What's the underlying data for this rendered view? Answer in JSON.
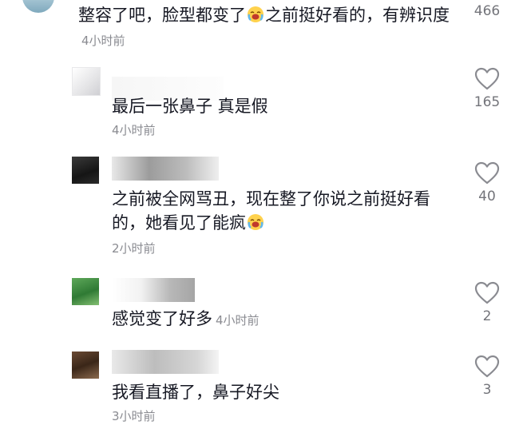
{
  "comments": [
    {
      "text_a": "整容了吧，脸型都变了",
      "text_b": "之前挺好看的，有辨识度",
      "time": "4小时前",
      "likes": "466",
      "emoji": "crying-laugh-emoji"
    },
    {
      "text": "最后一张鼻子 真是假",
      "time": "4小时前",
      "likes": "165"
    },
    {
      "text": "之前被全网骂丑，现在整了你说之前挺好看的，她看见了能疯",
      "time": "2小时前",
      "likes": "40",
      "emoji": "crying-laugh-emoji"
    },
    {
      "text": "感觉变了好多",
      "time": "4小时前",
      "likes": "2"
    },
    {
      "text": "我看直播了，鼻子好尖",
      "time": "3小时前",
      "likes": "3"
    }
  ],
  "icons": {
    "like": "heart-outline-icon"
  }
}
